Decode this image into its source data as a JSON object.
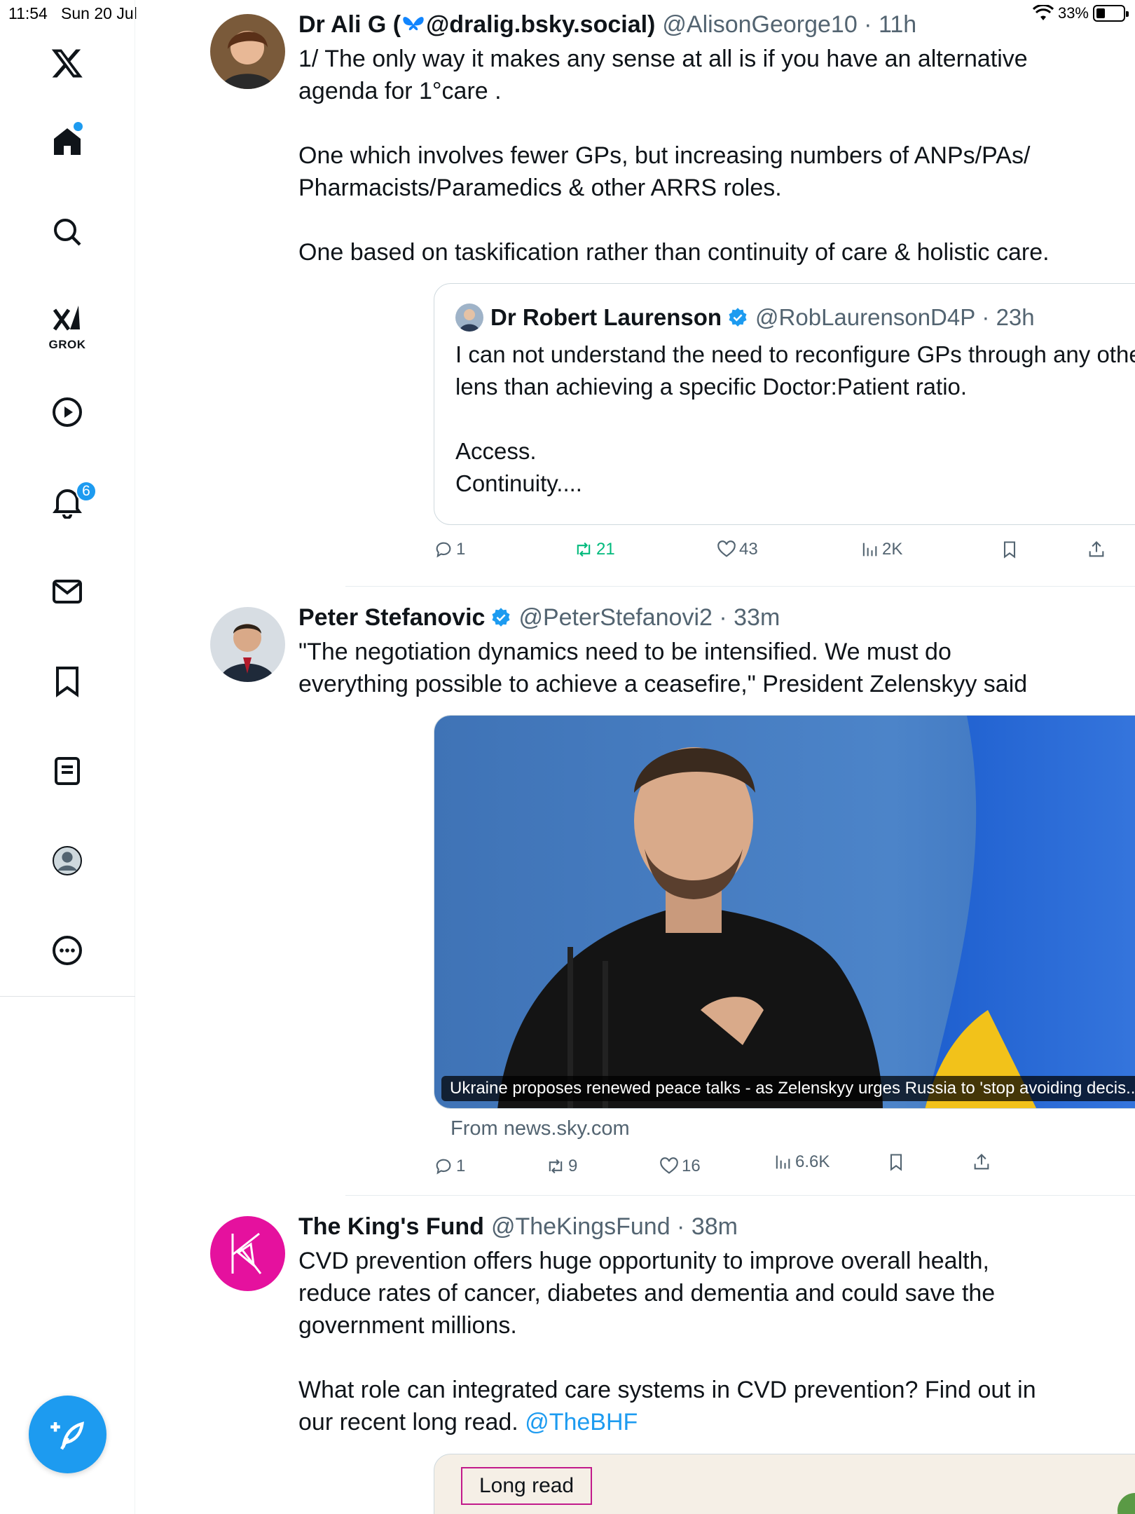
{
  "status_bar": {
    "time": "11:54",
    "date": "Sun 20 Jul",
    "battery": "33%",
    "battery_level": 0.33
  },
  "sidebar": {
    "logo": "x-logo-icon",
    "items": [
      {
        "name": "home",
        "icon": "home-icon"
      },
      {
        "name": "explore",
        "icon": "search-icon"
      },
      {
        "name": "grok",
        "icon": "grok-icon",
        "label": "GROK"
      },
      {
        "name": "video",
        "icon": "play-icon"
      },
      {
        "name": "notifications",
        "icon": "bell-icon",
        "badge": "6"
      },
      {
        "name": "messages",
        "icon": "mail-icon"
      },
      {
        "name": "bookmarks",
        "icon": "bookmark-icon"
      },
      {
        "name": "lists",
        "icon": "list-icon"
      },
      {
        "name": "profile",
        "icon": "profile-icon"
      },
      {
        "name": "more",
        "icon": "more-circle-icon"
      }
    ],
    "compose_icon": "compose-icon"
  },
  "tweets": [
    {
      "name": "Dr Ali G (",
      "name_suffix": " @dralig.bsky.social)",
      "handle": "@AlisonGeorge10",
      "time": "11h",
      "body": "1/ The only way it makes any sense at all is if you have an alternative agenda for 1°care .\n\nOne which involves fewer GPs, but increasing numbers of ANPs/PAs/\nPharmacists/Paramedics & other ARRS roles.\n\nOne based on taskification rather than continuity of care & holistic care.",
      "quote": {
        "name": "Dr Robert Laurenson",
        "handle": "@RobLaurensonD4P",
        "time": "23h",
        "body": "I can not understand the need to reconfigure GPs through any other lens than achieving a specific Doctor:Patient ratio.\n\nAccess.\nContinuity...."
      },
      "replies": "1",
      "retweets": "21",
      "likes": "43",
      "views": "2K"
    },
    {
      "name": "Peter Stefanovic",
      "handle": "@PeterStefanovi2",
      "time": "33m",
      "more": "···",
      "body": "\"The negotiation dynamics need to be intensified. We must do everything possible to achieve a ceasefire,\" President Zelenskyy said",
      "media_caption": "Ukraine proposes renewed peace talks - as Zelenskyy urges Russia to 'stop avoiding decis...",
      "from": "From news.sky.com",
      "replies": "1",
      "retweets": "9",
      "likes": "16",
      "views": "6.6K"
    },
    {
      "name": "The King's Fund",
      "handle": "@TheKingsFund",
      "time": "38m",
      "more": "···",
      "body_1": "CVD prevention offers huge opportunity to improve overall health, reduce rates of cancer, diabetes and dementia and could save the government millions.\n\nWhat role can integrated care systems in CVD prevention? Find out in our recent long read. ",
      "mention": "@TheBHF",
      "card_label": "Long read"
    }
  ],
  "colors": {
    "accent": "#1d9bf0",
    "retweet_green": "#00ba7c",
    "kings_fund_magenta": "#e5119e"
  }
}
